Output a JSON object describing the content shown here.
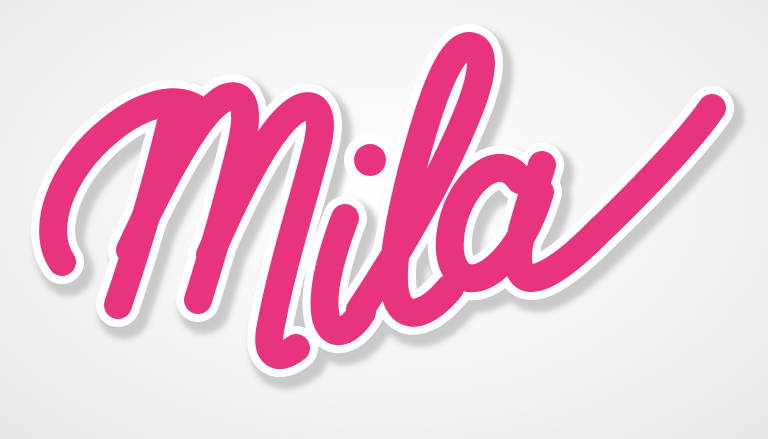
{
  "logo": {
    "wordmark": "Mila",
    "fill_color": "#e8337e",
    "outline_color": "#ffffff",
    "shadow_color": "#c9c9cc",
    "background_color": "#f3f3f4"
  }
}
